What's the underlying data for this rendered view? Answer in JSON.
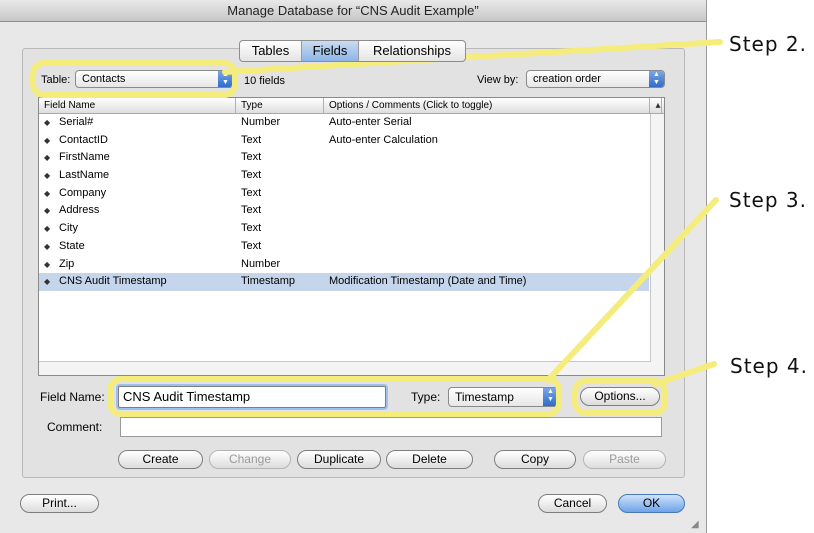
{
  "window": {
    "title": "Manage Database for “CNS Audit Example”"
  },
  "tabs": [
    {
      "label": "Tables",
      "active": false
    },
    {
      "label": "Fields",
      "active": true
    },
    {
      "label": "Relationships",
      "active": false
    }
  ],
  "table_select": {
    "label": "Table:",
    "value": "Contacts",
    "field_count": "10 fields"
  },
  "view_by": {
    "label": "View by:",
    "value": "creation order"
  },
  "columns": {
    "name": "Field Name",
    "type": "Type",
    "options": "Options / Comments   (Click to toggle)"
  },
  "fields": [
    {
      "name": "Serial#",
      "type": "Number",
      "options": "Auto-enter Serial"
    },
    {
      "name": "ContactID",
      "type": "Text",
      "options": "Auto-enter Calculation"
    },
    {
      "name": "FirstName",
      "type": "Text",
      "options": ""
    },
    {
      "name": "LastName",
      "type": "Text",
      "options": ""
    },
    {
      "name": "Company",
      "type": "Text",
      "options": ""
    },
    {
      "name": "Address",
      "type": "Text",
      "options": ""
    },
    {
      "name": "City",
      "type": "Text",
      "options": ""
    },
    {
      "name": "State",
      "type": "Text",
      "options": ""
    },
    {
      "name": "Zip",
      "type": "Number",
      "options": ""
    },
    {
      "name": "CNS Audit Timestamp",
      "type": "Timestamp",
      "options": "Modification Timestamp (Date and Time)",
      "selected": true
    }
  ],
  "field_editor": {
    "name_label": "Field Name:",
    "name_value": "CNS Audit Timestamp",
    "type_label": "Type:",
    "type_value": "Timestamp",
    "options_button": "Options...",
    "comment_label": "Comment:",
    "comment_value": ""
  },
  "actions": {
    "create": "Create",
    "change": "Change",
    "duplicate": "Duplicate",
    "delete": "Delete",
    "copy": "Copy",
    "paste": "Paste"
  },
  "footer": {
    "print": "Print...",
    "cancel": "Cancel",
    "ok": "OK"
  },
  "annotations": {
    "step2": "Step 2.",
    "step3": "Step 3.",
    "step4": "Step 4.",
    "highlight_color": "#f5ec7e"
  },
  "colors": {
    "selected_row": "#c5d5ec",
    "active_tab": "#8eb5e6",
    "default_button": "#6fa3e8"
  }
}
